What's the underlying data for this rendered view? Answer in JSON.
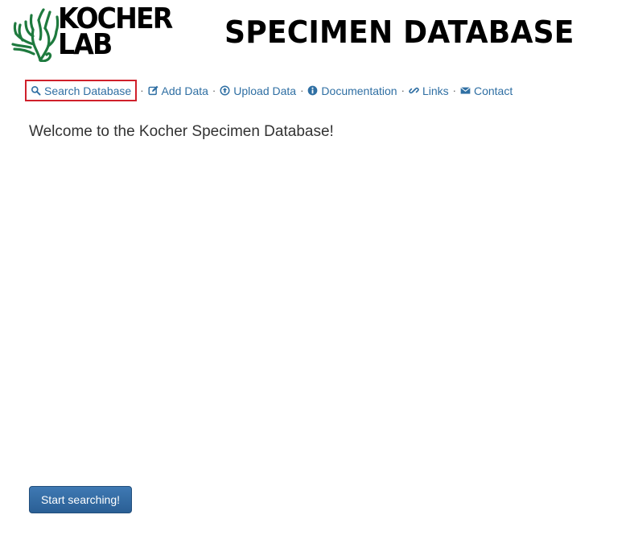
{
  "logo": {
    "line1": "KOCHER",
    "line2": "LAB",
    "mark_icon": "coral-tree-icon",
    "mark_color": "#1e7a3e"
  },
  "site_title": "SPECIMEN DATABASE",
  "nav": {
    "items": [
      {
        "label": "Search Database",
        "icon": "search-icon"
      },
      {
        "label": "Add Data",
        "icon": "edit-icon"
      },
      {
        "label": "Upload Data",
        "icon": "upload-icon"
      },
      {
        "label": "Documentation",
        "icon": "info-icon"
      },
      {
        "label": "Links",
        "icon": "link-icon"
      },
      {
        "label": "Contact",
        "icon": "envelope-icon"
      }
    ],
    "separator": "·",
    "link_color": "#2f6fa3",
    "highlight_color": "#d0202b"
  },
  "welcome_text": "Welcome to the Kocher Specimen Database!",
  "start_button": {
    "label": "Start searching!",
    "color": "#2f6aa5"
  }
}
